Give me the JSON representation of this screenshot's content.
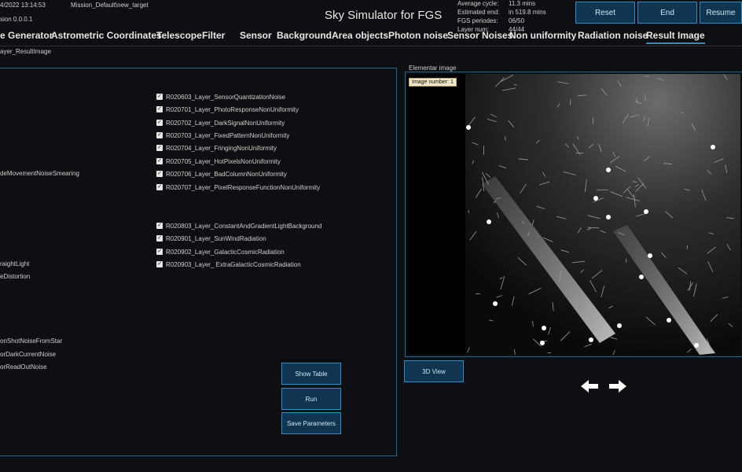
{
  "header": {
    "timestamp": "4/2022 13:14:53",
    "mission": "Mission_Default\\new_target",
    "version": "sion 0.0.0.1",
    "app_title": "Sky Simulator for FGS",
    "stats": [
      {
        "label": "Average cycle:",
        "value": "11.3 mins"
      },
      {
        "label": "Estimated end:",
        "value": "in 519.8 mins"
      },
      {
        "label": "FGS periodes:",
        "value": "06/50"
      },
      {
        "label": "Layer num:",
        "value": "44/44"
      }
    ],
    "buttons": {
      "reset": "Reset",
      "end": "End",
      "resume": "Resume"
    }
  },
  "tabs": [
    "e Generator",
    "Astrometric Coordinates",
    "Telescope",
    "Filter",
    "Sensor",
    "Background",
    "Area objects",
    "Photon noise",
    "Sensor Noises",
    "Non uniformity",
    "Radiation noise",
    "Result Image"
  ],
  "active_tab": "Result Image",
  "breadcrumb": "ayer_ResultImage",
  "left_items": [
    "deMovementNoiseSmearing",
    "raightLight",
    "eDistortion",
    "onShotNoiseFromStar",
    "orDarkCurrentNoise",
    "orReadOutNoise"
  ],
  "checked_layers": [
    "R020603_Layer_SensorQuantizationNoise",
    "R020701_Layer_PhotoResponseNonUniformity",
    "R020702_Layer_DarkSignalNonUniformity",
    "R020703_Layer_FixedPatternNonUniformity",
    "R020704_Layer_FringingNonUniformity",
    "R020705_Layer_HotPixelsNonUniformity",
    "R020706_Layer_BadColumnNonUniformity",
    "R020707_Layer_PixelResponseFunctionNonUniformity",
    "R020803_Layer_ConstantAndGradientLightBackground",
    "R020901_Layer_SunWindRadiation",
    "R020902_Layer_GalacticCosmicRadiation",
    "R020903_Layer_ ExtraGalacticCosmicRadiation"
  ],
  "actions": {
    "show_table": "Show Table",
    "run": "Run",
    "save_parameters": "Save Parameters"
  },
  "image_panel": {
    "group_title": "Elementar image",
    "image_number": "Image number: 1",
    "view3d": "3D View"
  },
  "colors": {
    "accent": "#2e8fc6",
    "button_bg": "#0f3550",
    "background": "#0d0f12"
  }
}
